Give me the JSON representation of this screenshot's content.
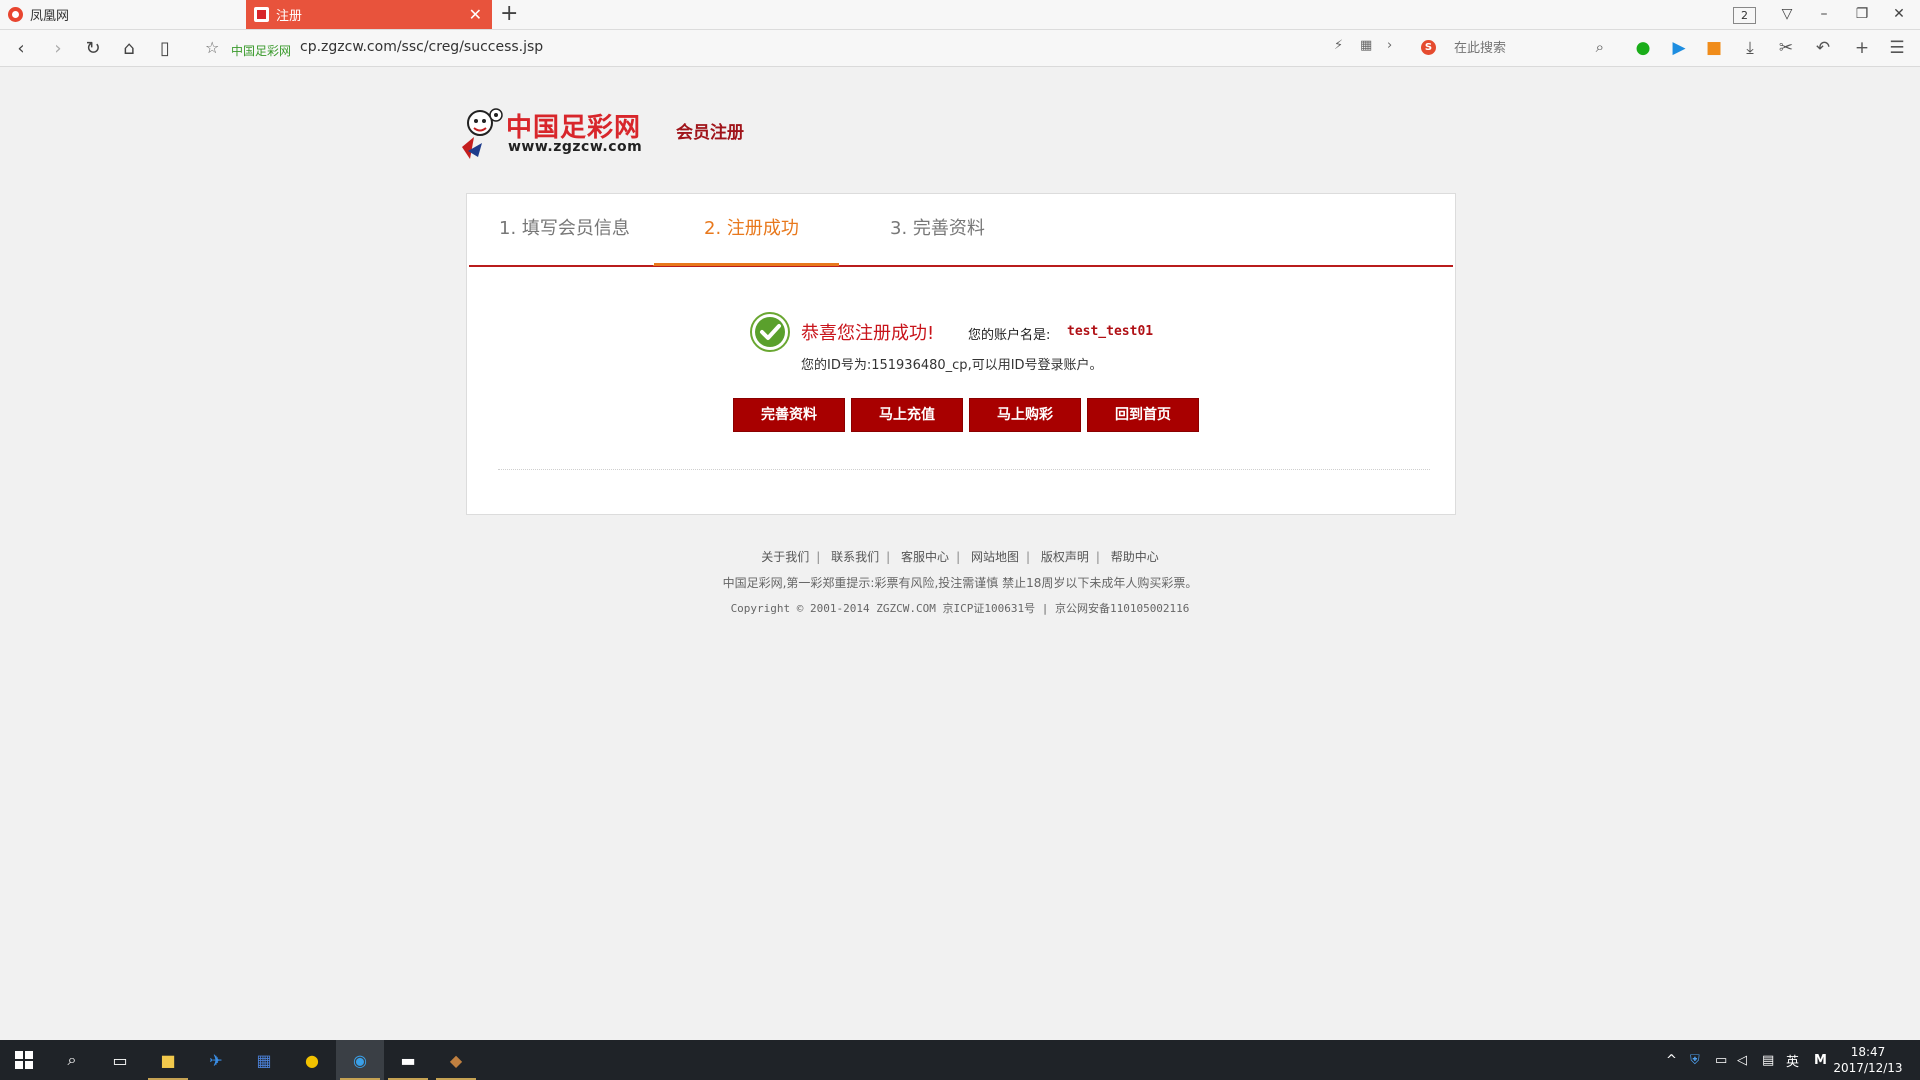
{
  "browser": {
    "tabs": [
      {
        "label": "凤凰网"
      },
      {
        "label": "注册"
      }
    ],
    "tab_count": "2",
    "site_label": "中国足彩网",
    "url": "cp.zgzcw.com/ssc/creg/success.jsp",
    "search_placeholder": "在此搜索"
  },
  "page": {
    "logo_title": "中国足彩网",
    "logo_url": "www.zgzcw.com",
    "title": "会员注册",
    "steps": [
      {
        "label": "1. 填写会员信息"
      },
      {
        "label": "2. 注册成功"
      },
      {
        "label": "3. 完善资料"
      }
    ],
    "success_title": "恭喜您注册成功!",
    "account_label": "您的账户名是:",
    "account_value": "test_test01",
    "id_line": "您的ID号为:151936480_cp,可以用ID号登录账户。",
    "buttons": [
      {
        "label": "完善资料"
      },
      {
        "label": "马上充值"
      },
      {
        "label": "马上购彩"
      },
      {
        "label": "回到首页"
      }
    ]
  },
  "footer": {
    "links": [
      "关于我们",
      "联系我们",
      "客服中心",
      "网站地图",
      "版权声明",
      "帮助中心"
    ],
    "separator": "|",
    "warning": "中国足彩网,第一彩郑重提示:彩票有风险,投注需谨慎 禁止18周岁以下未成年人购买彩票。",
    "copyright": "Copyright © 2001-2014 ZGZCW.COM 京ICP证100631号 | 京公网安备110105002116"
  },
  "taskbar": {
    "time": "18:47",
    "date": "2017/12/13",
    "ime": "英",
    "ime_mode": "M"
  },
  "colors": {
    "brand_red": "#a80000",
    "step_active": "#e8781c",
    "tab_active": "#e8533c",
    "success_green": "#5aa02c"
  }
}
